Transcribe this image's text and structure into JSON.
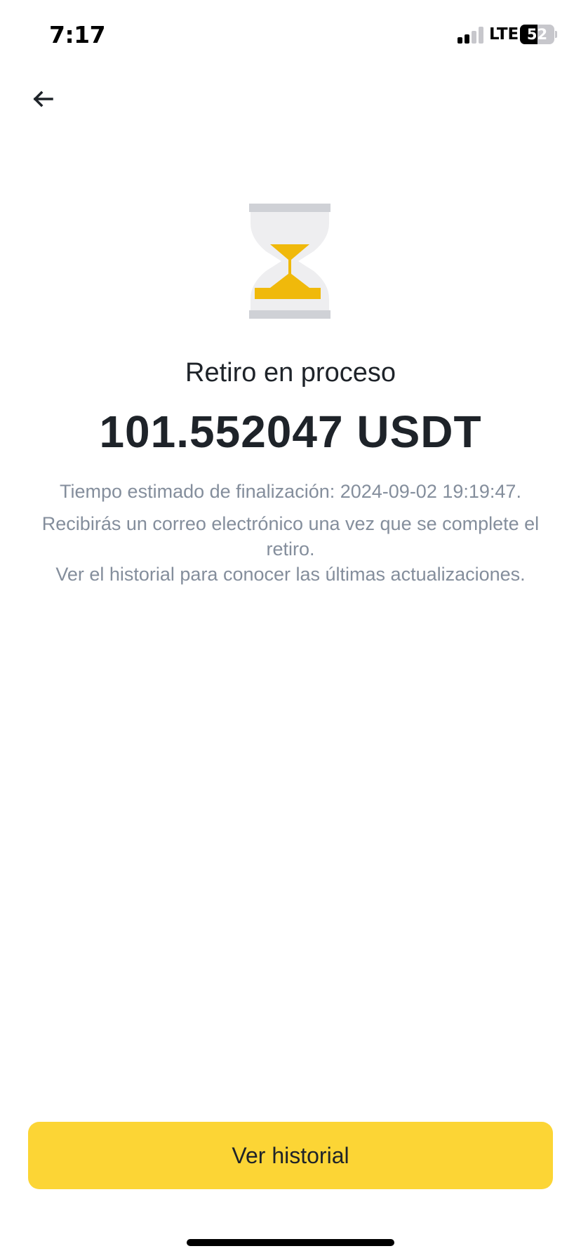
{
  "status_bar": {
    "time": "7:17",
    "network": "LTE",
    "battery": "52",
    "battery_level": 0.52,
    "signal_bars_active": 2,
    "signal_bars_total": 4
  },
  "nav": {
    "back_icon": "arrow-left-icon"
  },
  "status_icon": "hourglass-icon",
  "title": "Retiro en proceso",
  "amount": "101.552047 USDT",
  "info": {
    "eta": "Tiempo estimado de finalización: 2024-09-02 19:19:47.",
    "email_notice": "Recibirás un correo electrónico una vez que se complete el retiro.",
    "history_notice": "Ver el historial para conocer las últimas actualizaciones."
  },
  "actions": {
    "history_label": "Ver historial"
  },
  "colors": {
    "accent": "#fcd535",
    "hourglass_sand": "#f0b90b",
    "text_primary": "#1e2329",
    "text_secondary": "#848e9c"
  }
}
